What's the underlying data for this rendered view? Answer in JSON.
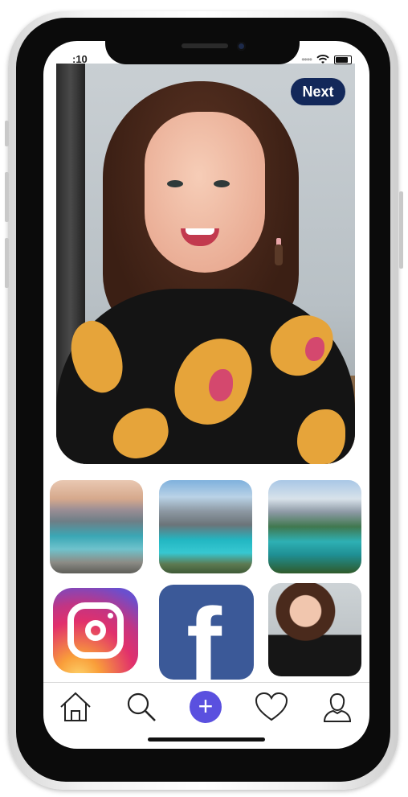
{
  "status_bar": {
    "time": ":10"
  },
  "header": {
    "next_label": "Next"
  },
  "tabs": [
    {
      "icon": "home-icon"
    },
    {
      "icon": "search-icon"
    },
    {
      "icon": "plus-icon",
      "label": "+"
    },
    {
      "icon": "heart-icon"
    },
    {
      "icon": "profile-icon"
    }
  ],
  "grid": [
    {
      "name": "lake-sunset-thumbnail"
    },
    {
      "name": "turquoise-lake-thumbnail"
    },
    {
      "name": "forest-lake-thumbnail"
    },
    {
      "name": "instagram-icon"
    },
    {
      "name": "facebook-icon"
    },
    {
      "name": "portrait-thumbnail"
    }
  ],
  "colors": {
    "accent": "#5a50df",
    "next_button": "#13285a",
    "facebook": "#3b5998"
  }
}
